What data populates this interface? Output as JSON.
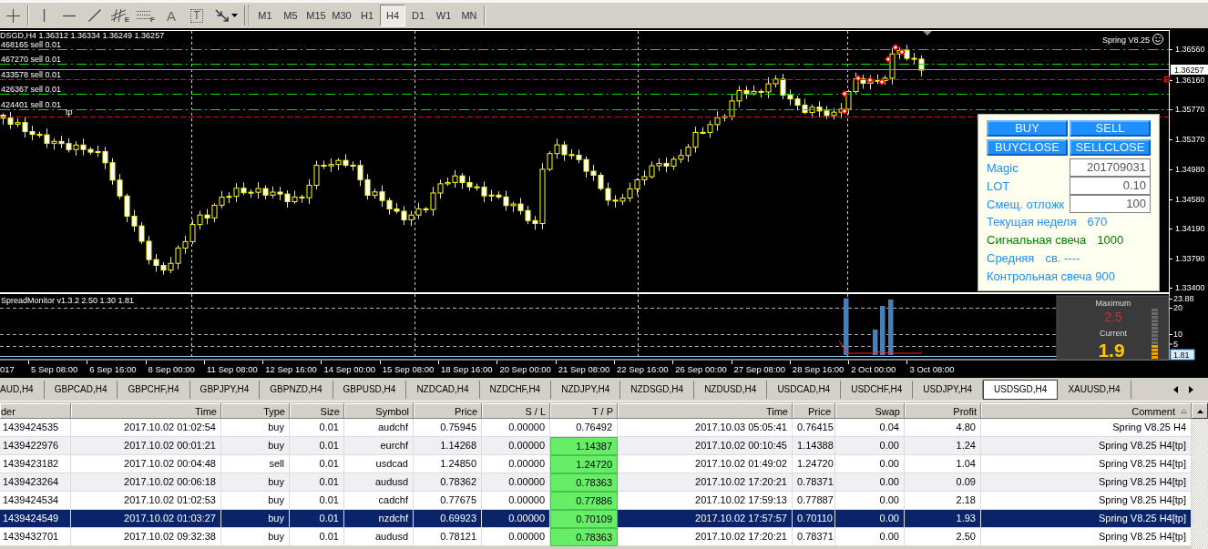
{
  "toolbar": {
    "tools": [
      {
        "kind": "crosshair"
      },
      {
        "kind": "vertical-line"
      },
      {
        "kind": "horizontal-line"
      },
      {
        "kind": "trendline"
      },
      {
        "kind": "channel",
        "glyph": "E"
      },
      {
        "kind": "grid",
        "glyph": "F"
      },
      {
        "kind": "text",
        "glyph": "A"
      },
      {
        "kind": "label",
        "glyph": "T"
      },
      {
        "kind": "arrows"
      }
    ],
    "timeframes": [
      {
        "label": "M1",
        "selected": false
      },
      {
        "label": "M5",
        "selected": false
      },
      {
        "label": "M15",
        "selected": false
      },
      {
        "label": "M30",
        "selected": false
      },
      {
        "label": "H1",
        "selected": false
      },
      {
        "label": "H4",
        "selected": true
      },
      {
        "label": "D1",
        "selected": false
      },
      {
        "label": "W1",
        "selected": false
      },
      {
        "label": "MN",
        "selected": false
      }
    ]
  },
  "chart": {
    "title": "DSGD,H4 1.36312 1.36334 1.36249 1.36257",
    "expert": "Spring V8.25",
    "order_lines": [
      {
        "label": "468165 sell 0.01",
        "color": "#00e000",
        "kind": "dashdot"
      },
      {
        "label": "467270 sell 0.01",
        "color": "#00e000",
        "kind": "dashdot"
      },
      {
        "label": "433578 sell 0.01",
        "color": "#ff0000",
        "kind": "dash"
      },
      {
        "label": "426367 sell 0.01",
        "color": "#00e000",
        "kind": "dashdot"
      },
      {
        "label": "424401 sell 0.01",
        "color": "#00e000",
        "kind": "dashdot"
      },
      {
        "label": "tp",
        "color": "#ff0000",
        "kind": "dash"
      }
    ],
    "current_price": "1.36257",
    "price_axis": [
      "1.36560",
      "1.36160",
      "1.35770",
      "1.35370",
      "1.34980",
      "1.34580",
      "1.34190",
      "1.33790",
      "1.33400"
    ],
    "panel": {
      "buttons": [
        "BUY",
        "SELL",
        "BUYCLOSE",
        "SELLCLOSE"
      ],
      "fields": [
        {
          "label": "Magic",
          "value": "201709031"
        },
        {
          "label": "LOT",
          "value": "0.10"
        },
        {
          "label": "Смещ. отложк",
          "value": "100"
        }
      ],
      "stats": [
        {
          "label": "Текущая неделя",
          "value": "670",
          "color": "#1e90ff"
        },
        {
          "label": "Сигнальная свеча",
          "value": "1000",
          "color": "#008000"
        },
        {
          "label": "Средняя",
          "value": "св. ----",
          "color": "#1e90ff"
        },
        {
          "label": "Контрольная свеча 900",
          "color": "#1e90ff"
        }
      ]
    }
  },
  "indicator": {
    "title": "SpreadMonitor v1.3.2 2.50 1.30 1.81",
    "axis": [
      "23.88",
      "20",
      "10",
      "5"
    ],
    "current_value": "1.81",
    "spread_box": {
      "max_label": "Maximum",
      "max_value": "2.5",
      "current_label": "Current",
      "current_value": "1.9",
      "meter": {
        "level": 0.25
      }
    }
  },
  "time_axis": [
    "017",
    "5 Sep 08:00",
    "6 Sep 16:00",
    "8 Sep 00:00",
    "11 Sep 08:00",
    "12 Sep 16:00",
    "14 Sep 00:00",
    "15 Sep 08:00",
    "18 Sep 16:00",
    "20 Sep 00:00",
    "21 Sep 08:00",
    "22 Sep 16:00",
    "26 Sep 00:00",
    "27 Sep 08:00",
    "28 Sep 16:00",
    "2 Oct 00:00",
    "3 Oct 08:00"
  ],
  "tabs": [
    {
      "label": "AUD,H4",
      "selected": false
    },
    {
      "label": "GBPCAD,H4",
      "selected": false
    },
    {
      "label": "GBPCHF,H4",
      "selected": false
    },
    {
      "label": "GBPJPY,H4",
      "selected": false
    },
    {
      "label": "GBPNZD,H4",
      "selected": false
    },
    {
      "label": "GBPUSD,H4",
      "selected": false
    },
    {
      "label": "NZDCAD,H4",
      "selected": false
    },
    {
      "label": "NZDCHF,H4",
      "selected": false
    },
    {
      "label": "NZDJPY,H4",
      "selected": false
    },
    {
      "label": "NZDSGD,H4",
      "selected": false
    },
    {
      "label": "NZDUSD,H4",
      "selected": false
    },
    {
      "label": "USDCAD,H4",
      "selected": false
    },
    {
      "label": "USDCHF,H4",
      "selected": false
    },
    {
      "label": "USDJPY,H4",
      "selected": false
    },
    {
      "label": "USDSGD,H4",
      "selected": true
    },
    {
      "label": "XAUUSD,H4",
      "selected": false
    }
  ],
  "table": {
    "columns": [
      {
        "label": "der",
        "sorted": false
      },
      {
        "label": "Time",
        "sorted": false
      },
      {
        "label": "Type",
        "sorted": false
      },
      {
        "label": "Size",
        "sorted": false
      },
      {
        "label": "Symbol",
        "sorted": false
      },
      {
        "label": "Price",
        "sorted": false
      },
      {
        "label": "S / L",
        "sorted": false
      },
      {
        "label": "T / P",
        "sorted": false
      },
      {
        "label": "Time",
        "sorted": false
      },
      {
        "label": "Price",
        "sorted": false
      },
      {
        "label": "Swap",
        "sorted": false
      },
      {
        "label": "Profit",
        "sorted": false
      },
      {
        "label": "Comment",
        "sorted": true
      }
    ],
    "rows": [
      {
        "cells": [
          "1439424535",
          "2017.10.02 01:02:54",
          "buy",
          "0.01",
          "audchf",
          "0.75945",
          "0.00000",
          "0.76492",
          "2017.10.03 05:05:41",
          "0.76415",
          "0.04",
          "4.80",
          "Spring V8.25 H4"
        ],
        "tp_highlighted": false,
        "selected": false
      },
      {
        "cells": [
          "1439422976",
          "2017.10.02 00:01:21",
          "buy",
          "0.01",
          "eurchf",
          "1.14268",
          "0.00000",
          "1.14387",
          "2017.10.02 00:10:45",
          "1.14388",
          "0.00",
          "1.24",
          "Spring V8.25 H4[tp]"
        ],
        "tp_highlighted": true,
        "selected": false
      },
      {
        "cells": [
          "1439423182",
          "2017.10.02 00:04:48",
          "sell",
          "0.01",
          "usdcad",
          "1.24850",
          "0.00000",
          "1.24720",
          "2017.10.02 01:49:02",
          "1.24720",
          "0.00",
          "1.04",
          "Spring V8.25 H4[tp]"
        ],
        "tp_highlighted": true,
        "selected": false
      },
      {
        "cells": [
          "1439423264",
          "2017.10.02 00:06:18",
          "buy",
          "0.01",
          "audusd",
          "0.78362",
          "0.00000",
          "0.78363",
          "2017.10.02 17:20:21",
          "0.78371",
          "0.00",
          "0.09",
          "Spring V8.25 H4[tp]"
        ],
        "tp_highlighted": true,
        "selected": false
      },
      {
        "cells": [
          "1439424534",
          "2017.10.02 01:02:53",
          "buy",
          "0.01",
          "cadchf",
          "0.77675",
          "0.00000",
          "0.77886",
          "2017.10.02 17:59:13",
          "0.77887",
          "0.00",
          "2.18",
          "Spring V8.25 H4[tp]"
        ],
        "tp_highlighted": true,
        "selected": false
      },
      {
        "cells": [
          "1439424549",
          "2017.10.02 01:03:27",
          "buy",
          "0.01",
          "nzdchf",
          "0.69923",
          "0.00000",
          "0.70109",
          "2017.10.02 17:57:57",
          "0.70110",
          "0.00",
          "1.93",
          "Spring V8.25 H4[tp]"
        ],
        "tp_highlighted": true,
        "selected": true
      },
      {
        "cells": [
          "1439432701",
          "2017.10.02 09:32:38",
          "buy",
          "0.01",
          "audusd",
          "0.78121",
          "0.00000",
          "0.78363",
          "2017.10.02 17:20:21",
          "0.78371",
          "0.00",
          "2.50",
          "Spring V8.25 H4[tp]"
        ],
        "tp_highlighted": true,
        "selected": false
      }
    ]
  }
}
